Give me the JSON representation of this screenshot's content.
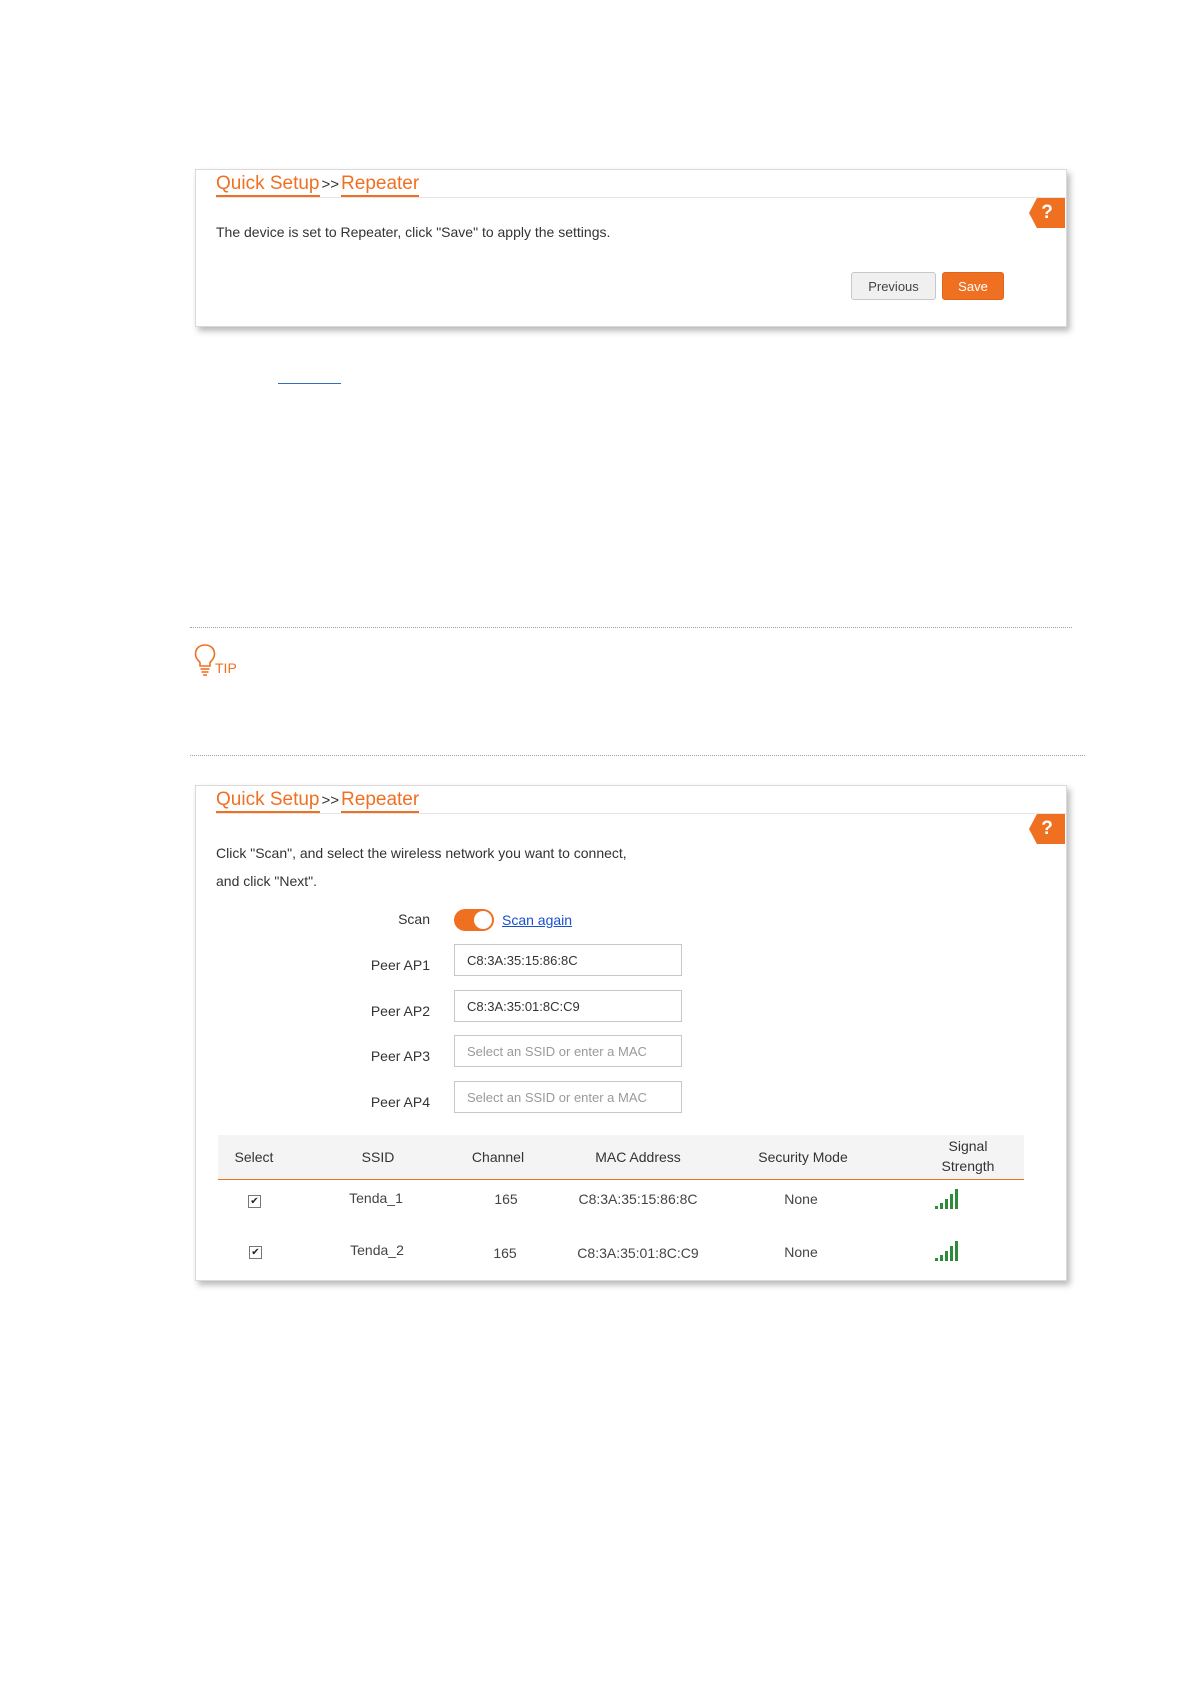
{
  "panel1": {
    "crumb_root": "Quick Setup",
    "crumb_separator": ">>",
    "crumb_current": "Repeater",
    "help_label": "?",
    "message": "The device is set to Repeater, click \"Save\" to apply the settings.",
    "previous_label": "Previous",
    "save_label": "Save"
  },
  "tip": {
    "label": "TIP"
  },
  "panel2": {
    "crumb_root": "Quick Setup",
    "crumb_separator": ">>",
    "crumb_current": "Repeater",
    "help_label": "?",
    "message_line1": "Click \"Scan\", and select the wireless network you want to connect,",
    "message_line2": "and click \"Next\".",
    "scan_label": "Scan",
    "scan_on": true,
    "scan_again_label": "Scan again",
    "peers": [
      {
        "label": "Peer AP1",
        "value": "C8:3A:35:15:86:8C",
        "placeholder": "Select an SSID or enter a MAC"
      },
      {
        "label": "Peer AP2",
        "value": "C8:3A:35:01:8C:C9",
        "placeholder": "Select an SSID or enter a MAC"
      },
      {
        "label": "Peer AP3",
        "value": "",
        "placeholder": "Select an SSID or enter a MAC"
      },
      {
        "label": "Peer AP4",
        "value": "",
        "placeholder": "Select an SSID or enter a MAC"
      }
    ],
    "table": {
      "headers": {
        "select": "Select",
        "ssid": "SSID",
        "channel": "Channel",
        "mac": "MAC Address",
        "security": "Security Mode",
        "signal_line1": "Signal",
        "signal_line2": "Strength"
      },
      "rows": [
        {
          "checked": true,
          "ssid": "Tenda_1",
          "channel": "165",
          "mac": "C8:3A:35:15:86:8C",
          "security": "None",
          "signal_icon": "signal-strength-icon",
          "signal_level": 1.0
        },
        {
          "checked": true,
          "ssid": "Tenda_2",
          "channel": "165",
          "mac": "C8:3A:35:01:8C:C9",
          "security": "None",
          "signal_icon": "signal-strength-icon",
          "signal_level": 1.0
        }
      ]
    }
  },
  "colors": {
    "accent": "#f07022",
    "link": "#1a4fd0",
    "signal": "#2e8b3a"
  }
}
